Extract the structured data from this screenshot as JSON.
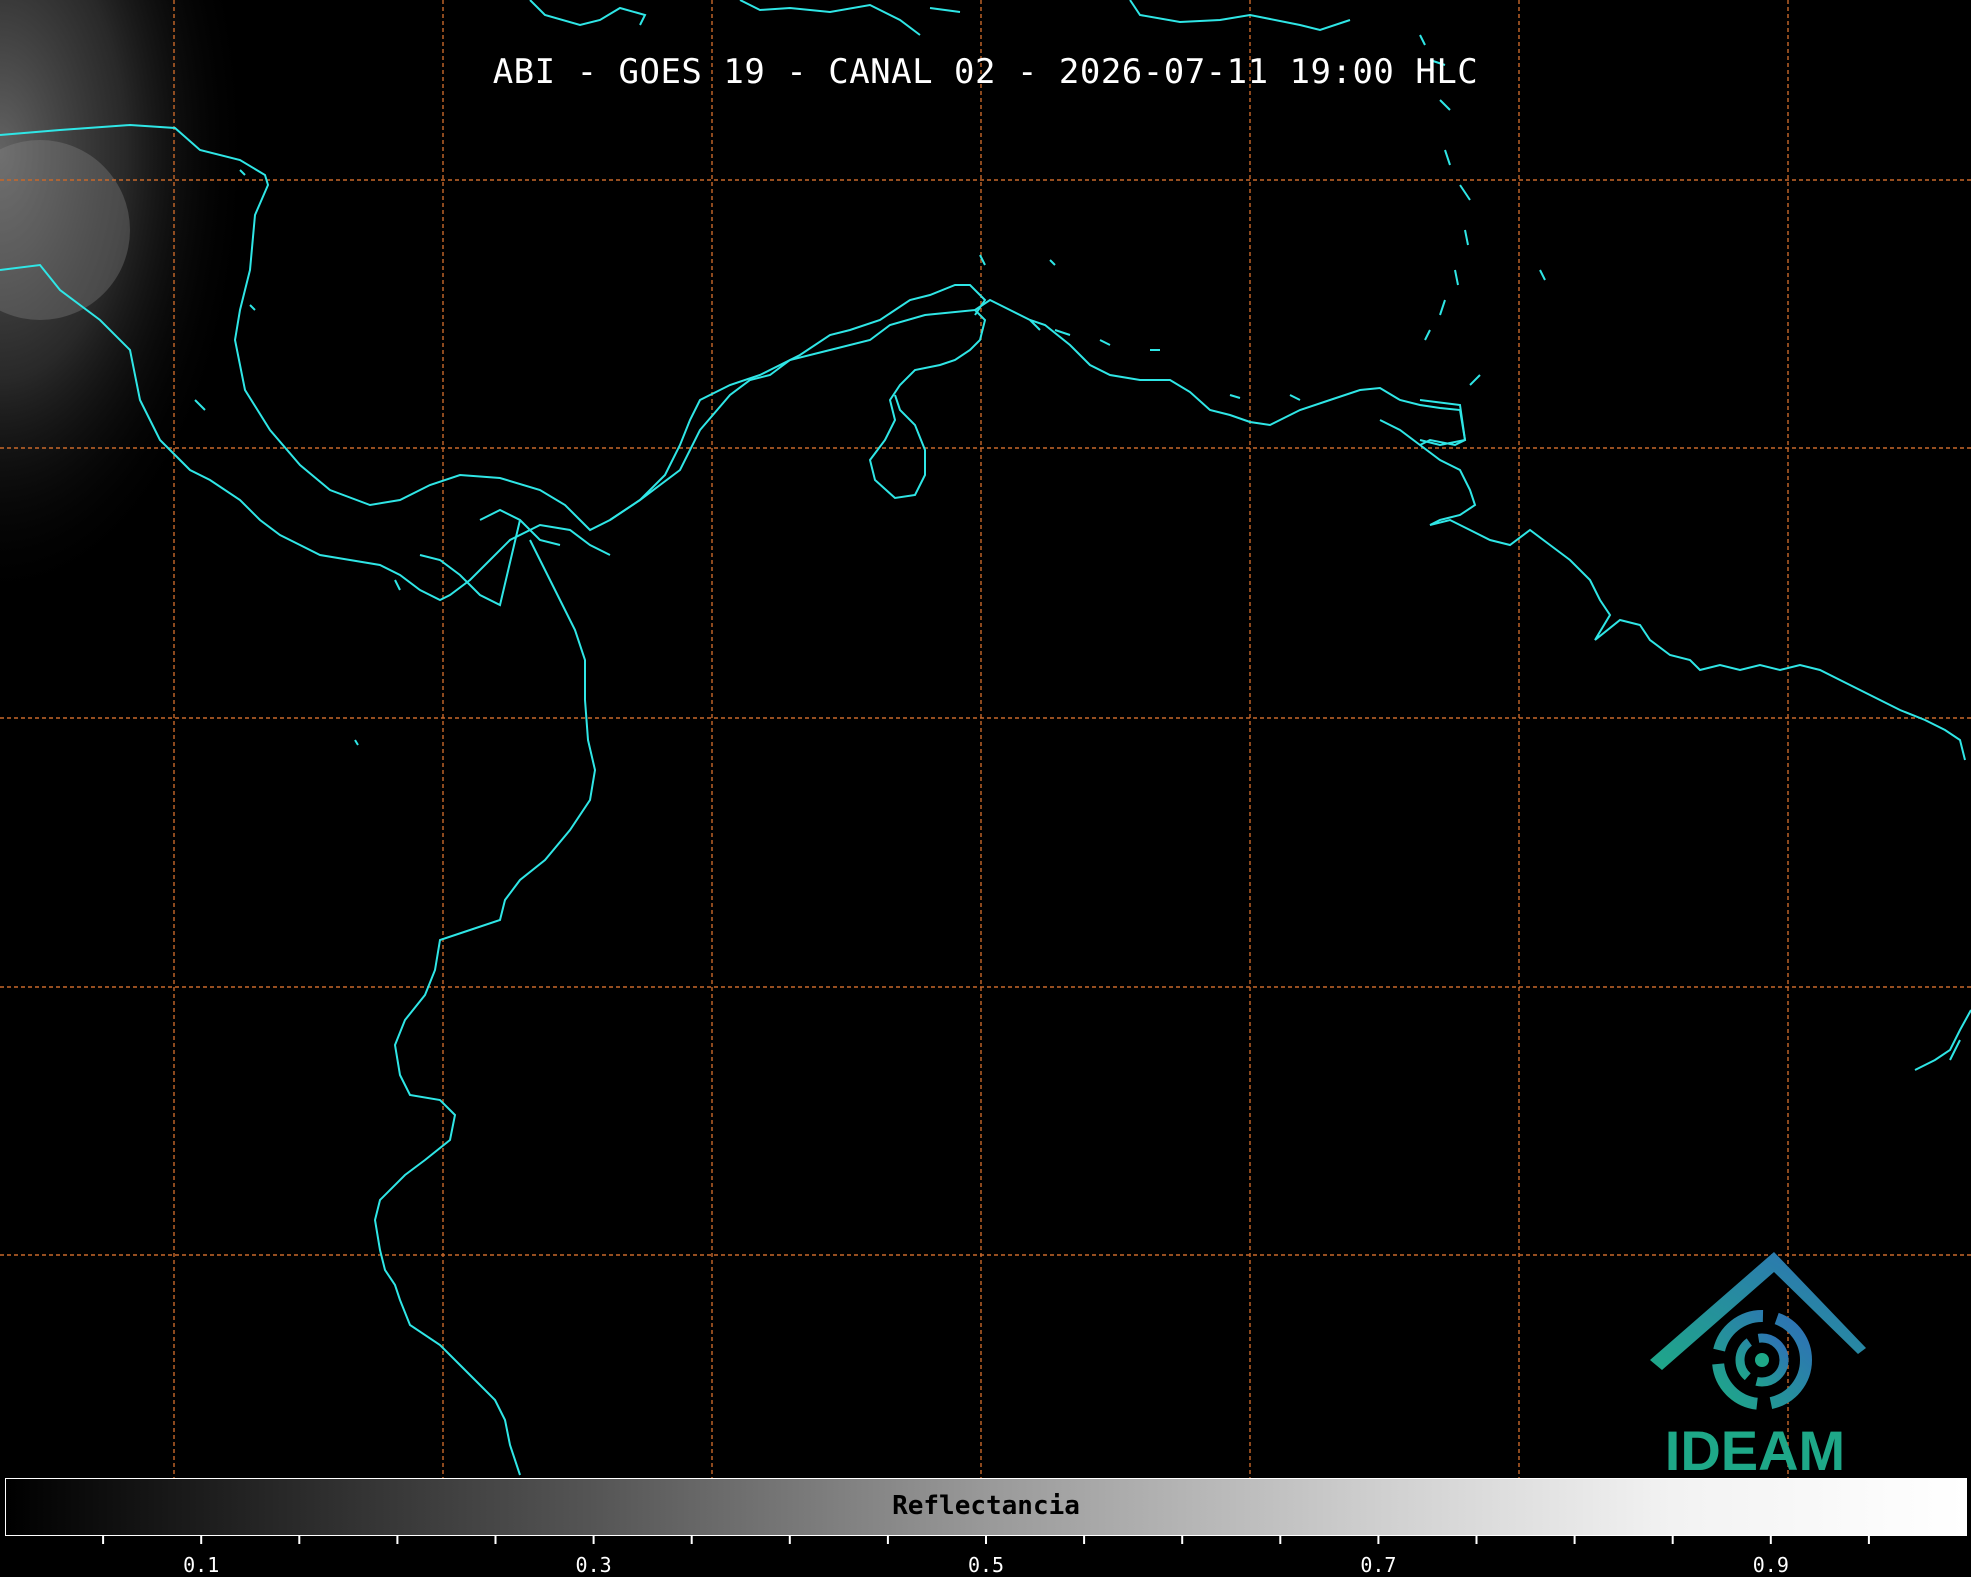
{
  "title": "ABI - GOES 19 - CANAL 02 - 2026-07-11 19:00 HLC",
  "colorbar": {
    "label": "Reflectancia",
    "tick_labels": [
      "0.1",
      "0.3",
      "0.5",
      "0.7",
      "0.9"
    ],
    "tick_values": [
      0.1,
      0.3,
      0.5,
      0.7,
      0.9
    ],
    "range": [
      0.0,
      1.0
    ]
  },
  "logo": {
    "text": "IDEAM"
  },
  "colors": {
    "coastline": "#2fe6e6",
    "graticule": "#c8682a",
    "background": "#000000",
    "logo_green": "#1ea888",
    "logo_blue": "#2f6fb8"
  }
}
